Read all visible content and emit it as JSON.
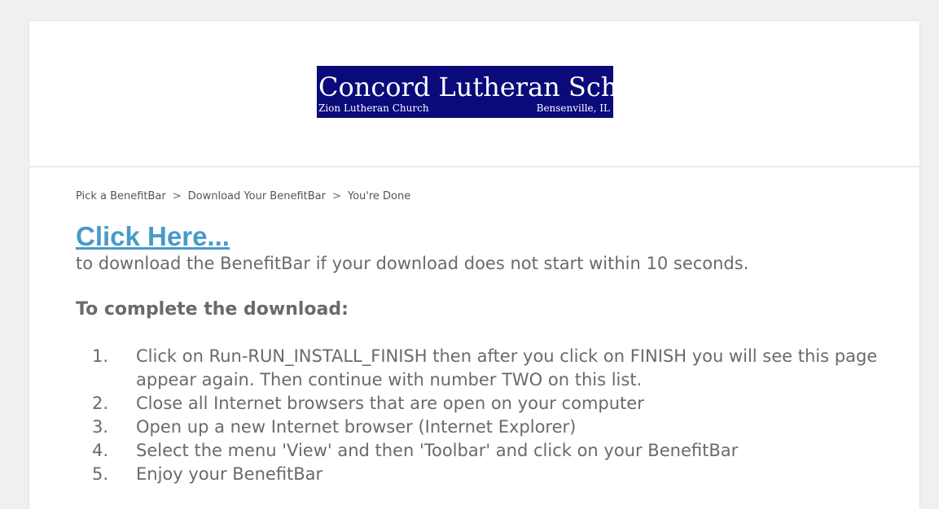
{
  "logo": {
    "title": "Concord Lutheran School",
    "subtitle_left": "Zion Lutheran Church",
    "subtitle_right": "Bensenville, IL"
  },
  "breadcrumb": {
    "step1": "Pick a BenefitBar",
    "step2": "Download Your BenefitBar",
    "step3": "You're Done",
    "separator": ">"
  },
  "download": {
    "link_label": "Click Here...",
    "description": "to download the BenefitBar if your download does not start within 10 seconds."
  },
  "instructions": {
    "title": "To complete the download:",
    "steps": [
      {
        "num": "1.",
        "text": "Click on Run-RUN_INSTALL_FINISH then after you click on FINISH you will see this page appear again. Then continue with number TWO on this list."
      },
      {
        "num": "2.",
        "text": "Close all Internet browsers that are open on your computer"
      },
      {
        "num": "3.",
        "text": "Open up a new Internet browser (Internet Explorer)"
      },
      {
        "num": "4.",
        "text": "Select the menu 'View' and then 'Toolbar' and click on your BenefitBar"
      },
      {
        "num": "5.",
        "text": "Enjoy your BenefitBar"
      }
    ]
  },
  "colors": {
    "link": "#4a9ac8",
    "text": "#6a6a6a",
    "logo_bg": "#0a0a7a",
    "page_bg": "#f0f0f0"
  }
}
